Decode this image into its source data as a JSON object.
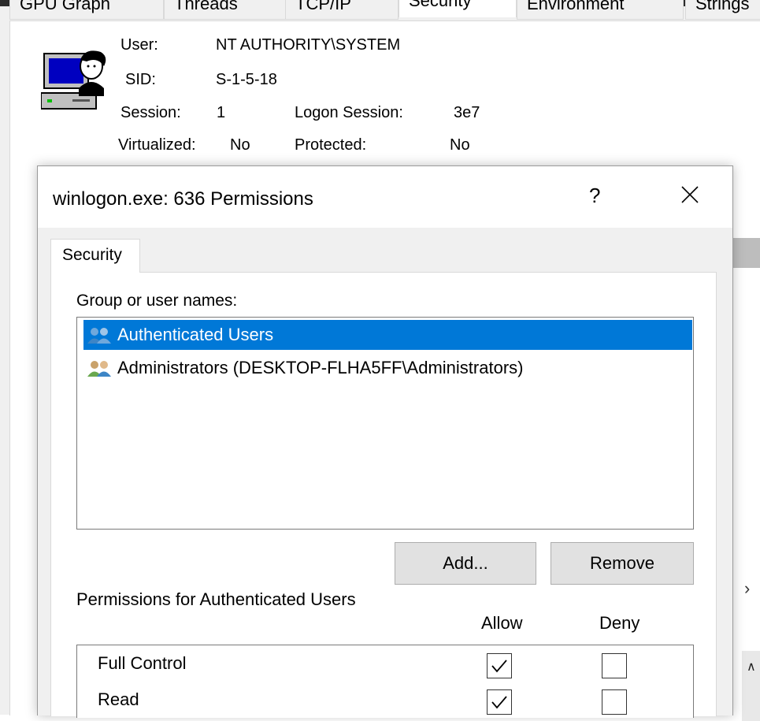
{
  "background_window": {
    "tabs": [
      "GPU Graph",
      "Threads",
      "TCP/IP",
      "Security",
      "Environment",
      "Strings"
    ],
    "active_tab": "Security",
    "security": {
      "user_label": "User:",
      "user_value": "NT AUTHORITY\\SYSTEM",
      "sid_label": "SID:",
      "sid_value": "S-1-5-18",
      "session_label": "Session:",
      "session_value": "1",
      "logon_session_label": "Logon Session:",
      "logon_session_value": "3e7",
      "virtualized_label": "Virtualized:",
      "virtualized_value": "No",
      "protected_label": "Protected:",
      "protected_value": "No"
    }
  },
  "dialog": {
    "title": "winlogon.exe: 636 Permissions",
    "help_label": "?",
    "tab_label": "Security",
    "group_label": "Group or user names:",
    "users": [
      {
        "name": "Authenticated Users",
        "selected": true
      },
      {
        "name": "Administrators (DESKTOP-FLHA5FF\\Administrators)",
        "selected": false
      }
    ],
    "add_button": "Add...",
    "remove_button": "Remove",
    "permissions_label": "Permissions for Authenticated Users",
    "allow_header": "Allow",
    "deny_header": "Deny",
    "permissions": [
      {
        "name": "Full Control",
        "allow": true,
        "deny": false
      },
      {
        "name": "Read",
        "allow": true,
        "deny": false
      }
    ]
  },
  "colors": {
    "selection": "#0078d7",
    "dialog_bg": "#f0f0f0",
    "button_bg": "#e1e1e1"
  }
}
